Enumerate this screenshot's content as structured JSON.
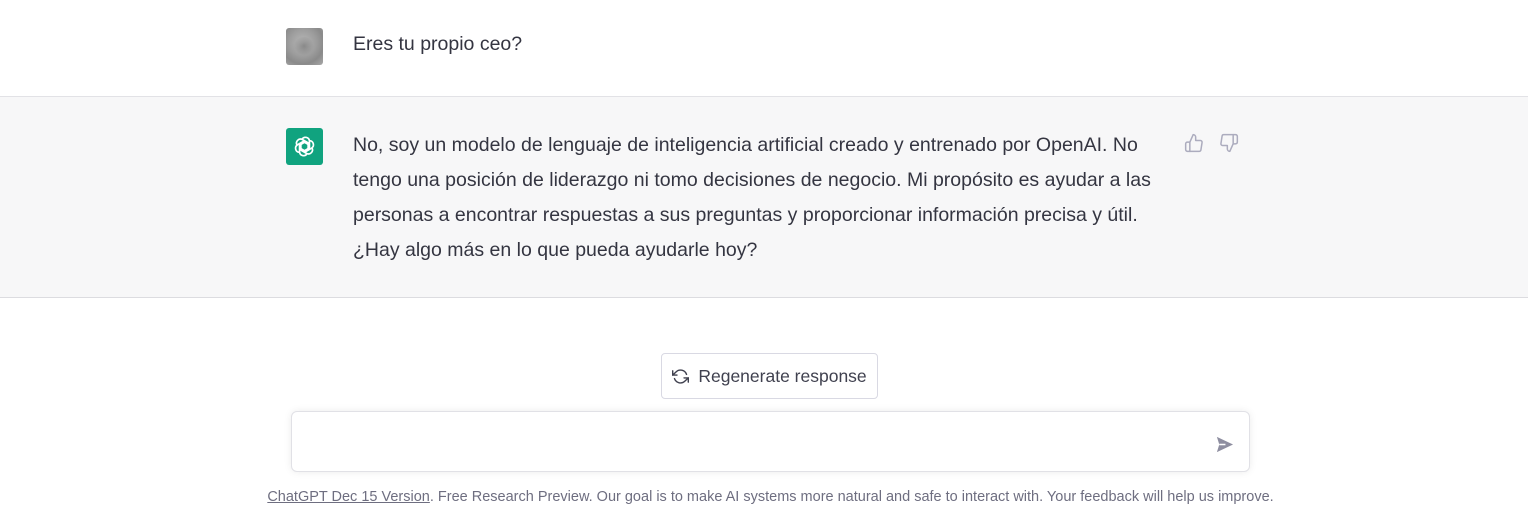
{
  "conversation": {
    "user_message": "Eres tu propio ceo?",
    "assistant_message": "No, soy un modelo de lenguaje de inteligencia artificial creado y entrenado por OpenAI. No tengo una posición de liderazgo ni tomo decisiones de negocio. Mi propósito es ayudar a las personas a encontrar respuestas a sus preguntas y proporcionar información precisa y útil. ¿Hay algo más en lo que pueda ayudarle hoy?"
  },
  "actions": {
    "regenerate_label": "Regenerate response"
  },
  "input": {
    "value": "",
    "placeholder": ""
  },
  "footer": {
    "version_link": "ChatGPT Dec 15 Version",
    "text": ". Free Research Preview. Our goal is to make AI systems more natural and safe to interact with. Your feedback will help us improve."
  },
  "colors": {
    "assistant_avatar": "#10a37f",
    "assistant_row_bg": "#f7f7f8",
    "text": "#343541",
    "muted": "#6e6e80"
  },
  "icons": {
    "assistant_avatar": "openai-logo-icon",
    "thumb_up": "thumbs-up-icon",
    "thumb_down": "thumbs-down-icon",
    "regenerate": "refresh-icon",
    "send": "send-icon"
  }
}
